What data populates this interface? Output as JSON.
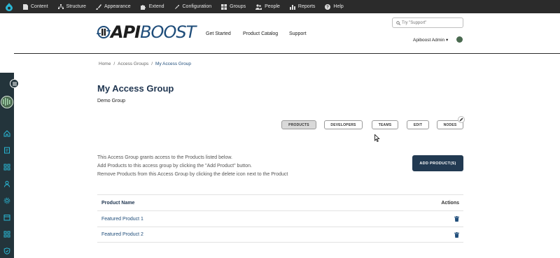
{
  "toolbar": {
    "items": [
      {
        "label": "Content",
        "icon": "file-icon"
      },
      {
        "label": "Structure",
        "icon": "sitemap-icon"
      },
      {
        "label": "Appearance",
        "icon": "paintbrush-icon"
      },
      {
        "label": "Extend",
        "icon": "puzzle-icon"
      },
      {
        "label": "Configuration",
        "icon": "wrench-icon"
      },
      {
        "label": "Groups",
        "icon": "groups-icon"
      },
      {
        "label": "People",
        "icon": "people-icon"
      },
      {
        "label": "Reports",
        "icon": "bar-chart-icon"
      },
      {
        "label": "Help",
        "icon": "help-icon"
      }
    ]
  },
  "header": {
    "logo_api": "API",
    "logo_boost": "BOOST",
    "nav": [
      "Get Started",
      "Product Catalog",
      "Support"
    ],
    "search_placeholder": "Try \"Support\"",
    "user_menu": "Apiboost Admin ▾"
  },
  "breadcrumb": {
    "home": "Home",
    "parent": "Access Groups",
    "current": "My Access Group"
  },
  "page": {
    "title": "My Access Group",
    "subtitle": "Demo Group"
  },
  "tabs": [
    {
      "label": "PRODUCTS",
      "active": true
    },
    {
      "label": "DEVELOPERS",
      "active": false
    },
    {
      "label": "TEAMS",
      "active": false
    },
    {
      "label": "EDIT",
      "active": false
    },
    {
      "label": "NODES",
      "active": false
    }
  ],
  "description": [
    "This Access Group grants access to the Products listed below.",
    "Add Products to this access group by clicking the \"Add Product\" button.",
    "Remove Products from this Access Group by clicking the delete icon next to the Product"
  ],
  "add_button": "ADD PRODUCT(S)",
  "table": {
    "headers": {
      "name": "Product Name",
      "actions": "Actions"
    },
    "rows": [
      {
        "name": "Featured Product 1"
      },
      {
        "name": "Featured Product 2"
      }
    ]
  },
  "colors": {
    "toolbar": "#2b2b2b",
    "sidebar": "#23343b",
    "accent": "#1f4d7a",
    "button": "#223a52",
    "sidebar_icon": "#2ab7d4"
  }
}
